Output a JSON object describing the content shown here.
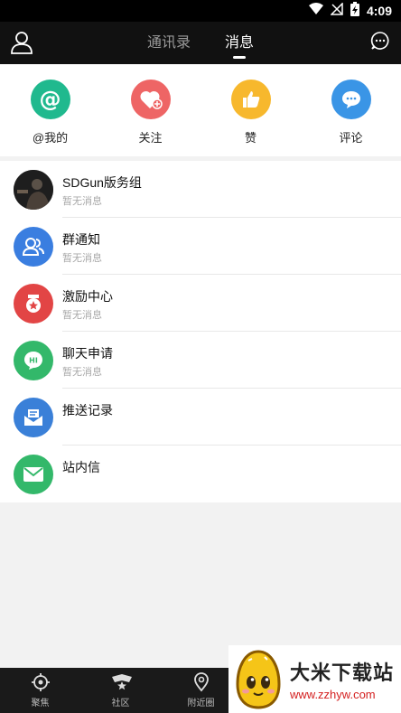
{
  "status_bar": {
    "time": "4:09"
  },
  "header": {
    "tabs": [
      {
        "label": "通讯录",
        "active": false
      },
      {
        "label": "消息",
        "active": true
      }
    ]
  },
  "quick_actions": [
    {
      "label": "@我的",
      "icon": "at-icon",
      "color": "#20b98e"
    },
    {
      "label": "关注",
      "icon": "heart-plus-icon",
      "color": "#ee6565"
    },
    {
      "label": "赞",
      "icon": "thumbs-up-icon",
      "color": "#f7b82d"
    },
    {
      "label": "评论",
      "icon": "comment-icon",
      "color": "#3a95e6"
    }
  ],
  "messages": [
    {
      "title": "SDGun版务组",
      "subtitle": "暂无消息",
      "icon": "photo-avatar"
    },
    {
      "title": "群通知",
      "subtitle": "暂无消息",
      "icon": "group-icon",
      "color": "#3a7ee0"
    },
    {
      "title": "激励中心",
      "subtitle": "暂无消息",
      "icon": "reward-icon",
      "color": "#e24545"
    },
    {
      "title": "聊天申请",
      "subtitle": "暂无消息",
      "icon": "hi-chat-icon",
      "color": "#33b86a"
    },
    {
      "title": "推送记录",
      "subtitle": "",
      "icon": "push-inbox-icon",
      "color": "#3a80d8"
    },
    {
      "title": "站内信",
      "subtitle": "",
      "icon": "mail-icon",
      "color": "#33b86a"
    }
  ],
  "bottom_nav": [
    {
      "label": "聚焦",
      "icon": "crosshair-icon"
    },
    {
      "label": "社区",
      "icon": "community-badge-icon"
    },
    {
      "label": "附近圈",
      "icon": "location-pin-icon"
    }
  ],
  "watermark": {
    "title": "大米下载站",
    "url": "www.zzhyw.com"
  }
}
